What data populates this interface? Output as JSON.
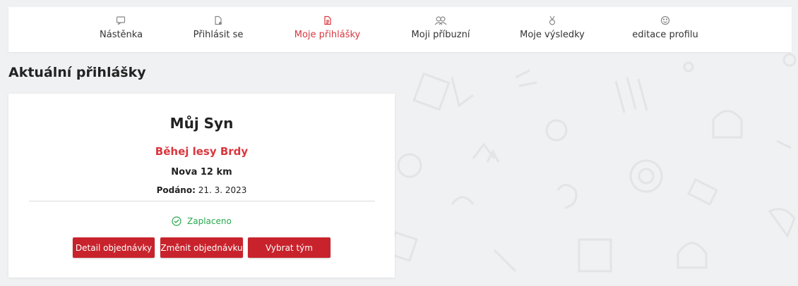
{
  "nav": {
    "items": [
      {
        "label": "Nástěnka",
        "icon": "message-icon"
      },
      {
        "label": "Přihlásit se",
        "icon": "document-add-icon"
      },
      {
        "label": "Moje přihlášky",
        "icon": "document-icon",
        "active": true
      },
      {
        "label": "Moji příbuzní",
        "icon": "users-icon"
      },
      {
        "label": "Moje výsledky",
        "icon": "medal-icon"
      },
      {
        "label": "editace profilu",
        "icon": "smiley-icon"
      }
    ]
  },
  "page": {
    "title": "Aktuální přihlášky"
  },
  "card": {
    "name": "Můj Syn",
    "race": "Běhej lesy Brdy",
    "category": "Nova 12 km",
    "submitted_label": "Podáno:",
    "submitted_date": "21. 3. 2023",
    "status": "Zaplaceno",
    "buttons": {
      "detail": "Detail objednávky",
      "change": "Změnit objednávku",
      "team": "Vybrat tým"
    }
  },
  "colors": {
    "accent": "#d9363e",
    "button": "#c8232c",
    "success": "#2aa84f"
  }
}
